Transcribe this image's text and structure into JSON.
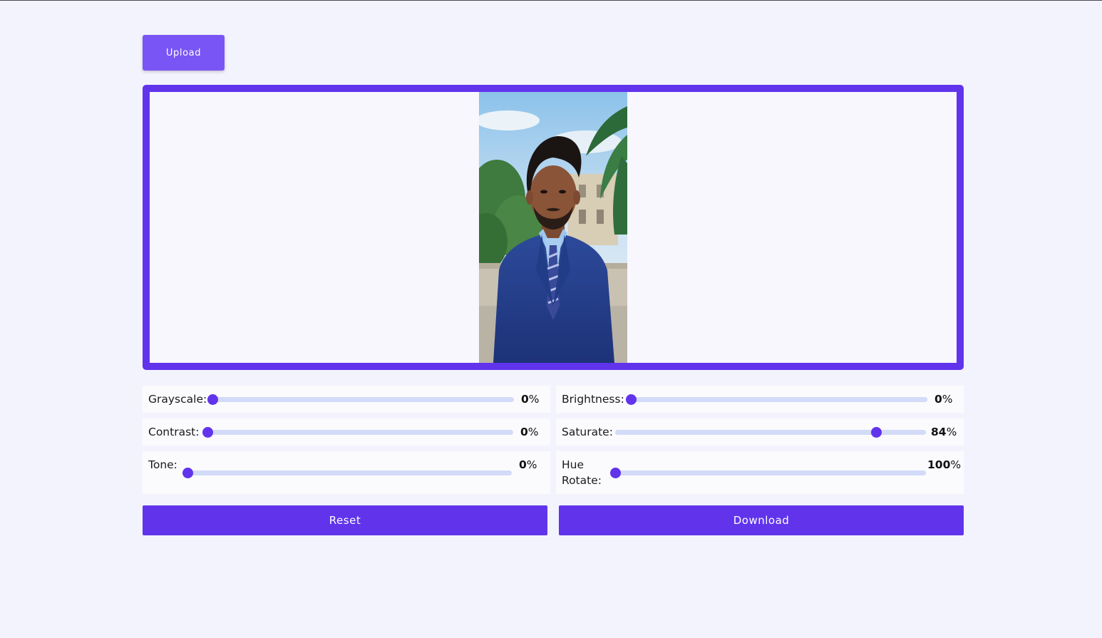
{
  "toolbar": {
    "upload_label": "Upload"
  },
  "editor": {
    "photo_alt": "Uploaded portrait photo"
  },
  "filters": {
    "grayscale": {
      "label": "Grayscale:",
      "value": "0",
      "unit": "%",
      "level": 0
    },
    "brightness": {
      "label": "Brightness:",
      "value": "0",
      "unit": "%",
      "level": 0
    },
    "contrast": {
      "label": "Contrast:",
      "value": "0",
      "unit": "%",
      "level": 0
    },
    "saturate": {
      "label": "Saturate:",
      "value": "84",
      "unit": "%",
      "level": 0.84
    },
    "tone": {
      "label": "Tone:",
      "value": "0",
      "unit": "%",
      "level": 0
    },
    "hue_rotate": {
      "label_line1": "Hue",
      "label_line2": "Rotate:",
      "value": "100",
      "unit": "%",
      "level": 0
    }
  },
  "actions": {
    "reset_label": "Reset",
    "download_label": "Download"
  },
  "colors": {
    "accent": "#6134ec",
    "upload_button": "#7a55f5",
    "slider_track": "#d2dbf7",
    "background": "#f3f3fd"
  }
}
